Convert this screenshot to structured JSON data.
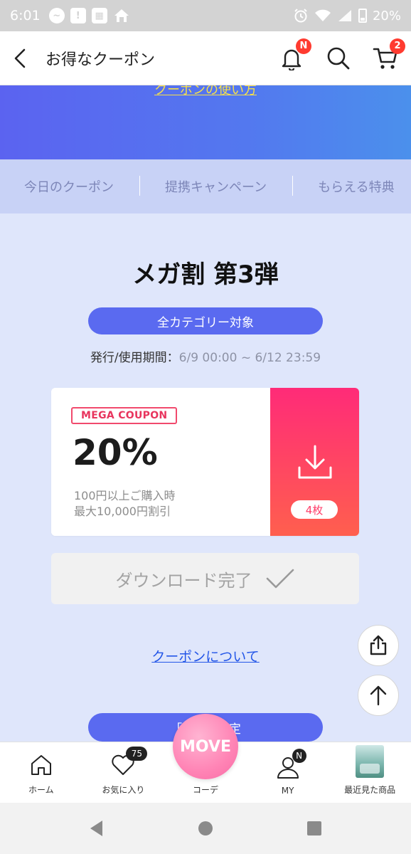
{
  "status_bar": {
    "time": "6:01",
    "battery": "20%",
    "icons": [
      "messenger-icon",
      "alert-icon",
      "app-grid-icon",
      "home-icon",
      "alarm-icon",
      "wifi-icon",
      "signal-icon",
      "battery-icon"
    ]
  },
  "header": {
    "title": "お得なクーポン",
    "notification_badge": "N",
    "cart_badge": "2"
  },
  "hero": {
    "link_text": "クーポンの使い方"
  },
  "tabs": [
    {
      "label": "今日のクーポン"
    },
    {
      "label": "提携キャンペーン"
    },
    {
      "label": "もらえる特典"
    }
  ],
  "event": {
    "title": "メガ割 第3弾",
    "category": "全カテゴリー対象",
    "period_label": "発行/使用期間：",
    "period_value": "6/9 00:00 ~ 6/12 23:59"
  },
  "coupon": {
    "tag": "MEGA COUPON",
    "discount": "20%",
    "condition_1": "100円以上ご購入時",
    "condition_2": "最大10,000円割引",
    "count": "4枚"
  },
  "download_done": {
    "label": "ダウンロード完了"
  },
  "about_link": "クーポンについて",
  "bottom_pill_text": "「M　　限定",
  "bottom_nav": {
    "home": "ホーム",
    "favorites": "お気に入り",
    "favorites_badge": "75",
    "move_logo": "MOVE",
    "coordinate": "コーデ",
    "my": "MY",
    "my_badge": "N",
    "recent": "最近見た商品"
  },
  "colors": {
    "accent": "#5a6af0",
    "coupon_gradient_top": "#ff2b78",
    "coupon_gradient_bottom": "#ff5f4e",
    "link": "#2356e8",
    "hero_link": "#f6e04a"
  }
}
